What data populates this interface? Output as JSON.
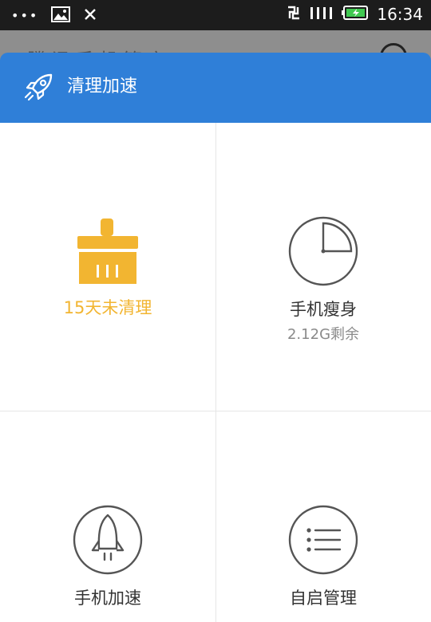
{
  "status_bar": {
    "time": "16:34",
    "icons": [
      "more-dots-icon",
      "gallery-icon",
      "close-icon",
      "sync-icon",
      "signal-icon",
      "battery-icon"
    ]
  },
  "backdrop": {
    "title": "腾讯手机管家"
  },
  "sheet": {
    "title": "清理加速",
    "header_color": "#2f7fd8"
  },
  "cells": [
    {
      "label": "15天未清理",
      "icon": "broom-icon",
      "color": "#f2b531"
    },
    {
      "label": "手机瘦身",
      "sub": "2.12G剩余",
      "icon": "pie-chart-icon",
      "color": "#333333"
    },
    {
      "label": "手机加速",
      "sub": "",
      "icon": "rocket-icon",
      "color": "#333333"
    },
    {
      "label": "自启管理",
      "sub": "",
      "icon": "list-icon",
      "color": "#333333"
    }
  ]
}
